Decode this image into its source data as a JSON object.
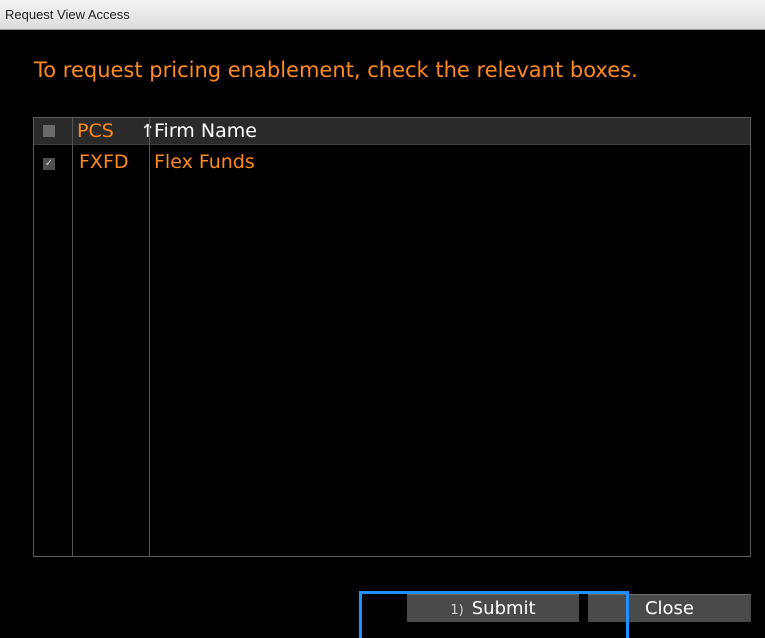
{
  "window": {
    "title": "Request View Access"
  },
  "instructions": "To request pricing enablement, check the relevant boxes.",
  "table": {
    "columns": {
      "select_all_checked": false,
      "pcs": "PCS",
      "sort_icon": "↑",
      "firm_name": "Firm Name"
    },
    "rows": [
      {
        "checked": true,
        "pcs": "FXFD",
        "firm_name": "Flex Funds"
      }
    ]
  },
  "buttons": {
    "submit_accel": "1)",
    "submit": "Submit",
    "close": "Close"
  },
  "colors": {
    "accent": "#ff8a1e",
    "highlight": "#1e90ff"
  }
}
